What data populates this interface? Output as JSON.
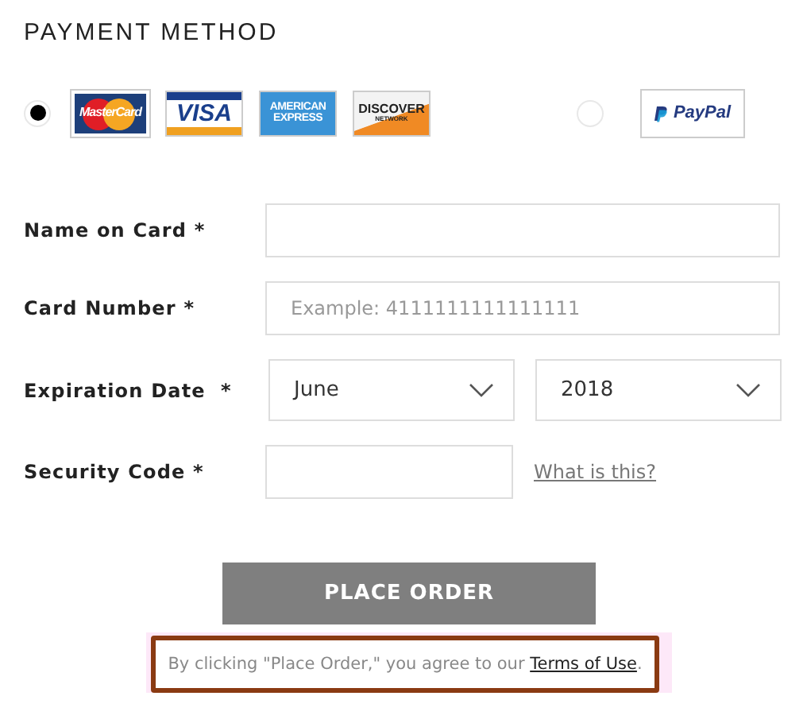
{
  "heading": "PAYMENT METHOD",
  "methods": [
    {
      "selected": true,
      "logos": [
        {
          "kind": "mastercard",
          "lines": [
            "MasterCard"
          ]
        },
        {
          "kind": "visa",
          "lines": [
            "VISA"
          ]
        },
        {
          "kind": "amex",
          "lines": [
            "AMERICAN",
            "EXPRESS"
          ]
        },
        {
          "kind": "discover",
          "lines": [
            "DISCOVER",
            "NETWORK"
          ]
        }
      ]
    },
    {
      "selected": false,
      "logos": [
        {
          "kind": "paypal",
          "lines": [
            "PayPal"
          ]
        }
      ]
    }
  ],
  "fields": [
    {
      "kind": "text",
      "label": "Name on Card *"
    },
    {
      "kind": "text",
      "label": "Card Number *",
      "placeholder": "Example: 4111111111111111"
    },
    {
      "kind": "selects",
      "label": "Expiration Date  *",
      "values": [
        "June",
        "2018"
      ]
    },
    {
      "kind": "short",
      "label": "Security Code *",
      "link": "What is this?"
    }
  ],
  "button": "PLACE ORDER",
  "note": {
    "text": "By clicking \"Place Order,\" you agree to our ",
    "link": "Terms of Use",
    "end": "."
  }
}
